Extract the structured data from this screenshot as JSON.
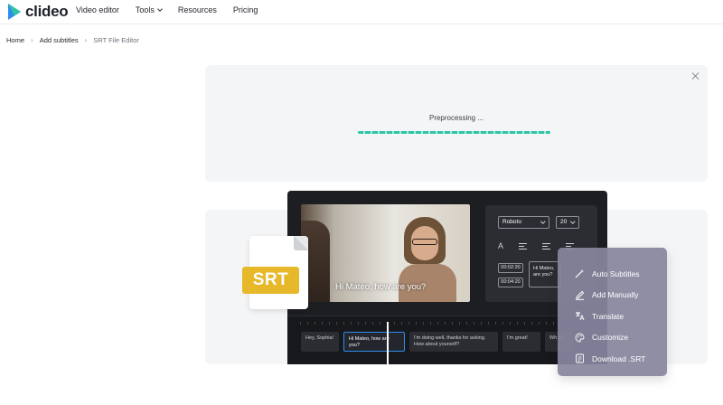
{
  "header": {
    "logo_text": "clideo",
    "nav": [
      "Video editor",
      "Tools",
      "Resources",
      "Pricing"
    ]
  },
  "breadcrumb": [
    "Home",
    "Add subtitles",
    "SRT File Editor"
  ],
  "progress": {
    "status": "Preprocessing ...",
    "fraction": 1.0
  },
  "editor": {
    "caption": "Hi Mateo, how are you?",
    "font": "Roboto",
    "font_size": "20",
    "text_tool": "A",
    "time_start": "00:02:20",
    "time_end": "00:04:20",
    "subtitle_preview": "Hi Mateo, are you?",
    "segments": [
      "Hey, Sophia!",
      "Hi Mateo, how are you?",
      "I'm doing well, thanks for asking. How about yourself?",
      "I'm great!",
      "Wh for"
    ]
  },
  "srt_label": "SRT",
  "menu": [
    "Auto Subtitles",
    "Add Manually",
    "Translate",
    "Customize",
    "Download .SRT"
  ],
  "colors": {
    "accent": "#2fc4a5",
    "logo_blue": "#2d8cf0",
    "srt_yellow": "#e6b82a",
    "menu_bg": "#88859e"
  },
  "icons": {
    "logo": "play-triangle-icon",
    "menu": [
      "magic-wand-icon",
      "pencil-icon",
      "translate-icon",
      "palette-icon",
      "document-icon"
    ]
  }
}
